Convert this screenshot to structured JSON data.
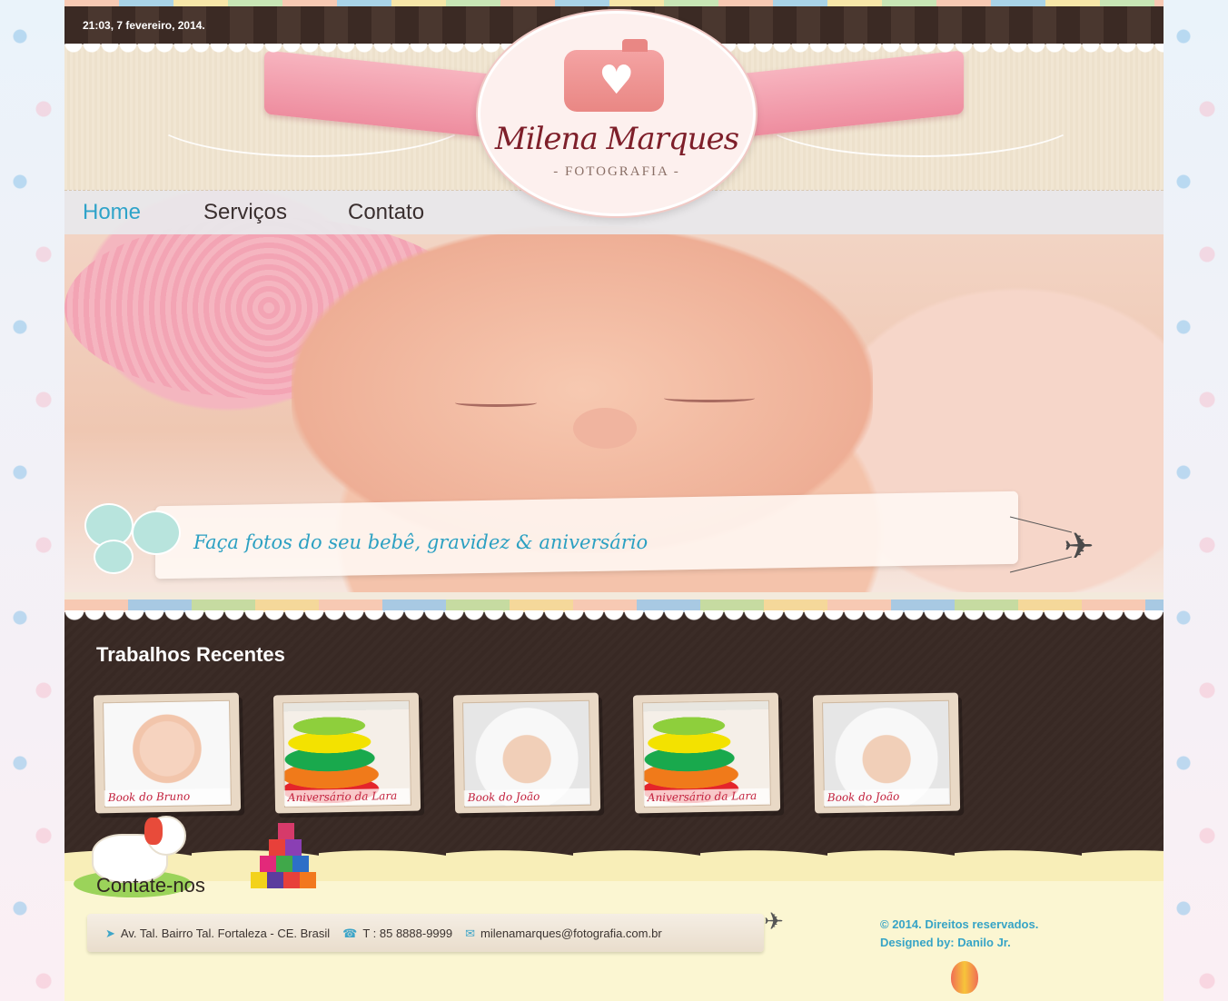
{
  "topbar": {
    "datetime": "21:03, 7 fevereiro, 2014."
  },
  "logo": {
    "name": "Milena Marques",
    "subtitle": "- FOTOGRAFIA -",
    "icon": "camera-heart-icon"
  },
  "nav": {
    "items": [
      {
        "label": "Home",
        "active": true
      },
      {
        "label": "Serviços",
        "active": false
      },
      {
        "label": "Contato",
        "active": false
      }
    ],
    "accent_color": "#2fa3c9"
  },
  "hero": {
    "tagline": "Faça fotos do seu bebê, gravidez & aniversário"
  },
  "recent": {
    "title": "Trabalhos Recentes",
    "items": [
      {
        "caption": "Book do Bruno",
        "image": "baby-pacifier"
      },
      {
        "caption": "Aniversário da Lara",
        "image": "stacking-rings-toy"
      },
      {
        "caption": "Book do João",
        "image": "baby-towel"
      },
      {
        "caption": "Aniversário da Lara",
        "image": "stacking-rings-toy"
      },
      {
        "caption": "Book do João",
        "image": "baby-towel"
      }
    ]
  },
  "contact": {
    "title": "Contate-nos",
    "address": "Av. Tal. Bairro Tal. Fortaleza - CE. Brasil",
    "phone": "T : 85 8888-9999",
    "email": "milenamarques@fotografia.com.br",
    "icons": {
      "address": "location-arrow-icon",
      "phone": "phone-icon",
      "email": "envelope-icon"
    }
  },
  "footer": {
    "copyright": "© 2014. Direitos reservados.",
    "designer": "Designed by: Danilo Jr."
  }
}
